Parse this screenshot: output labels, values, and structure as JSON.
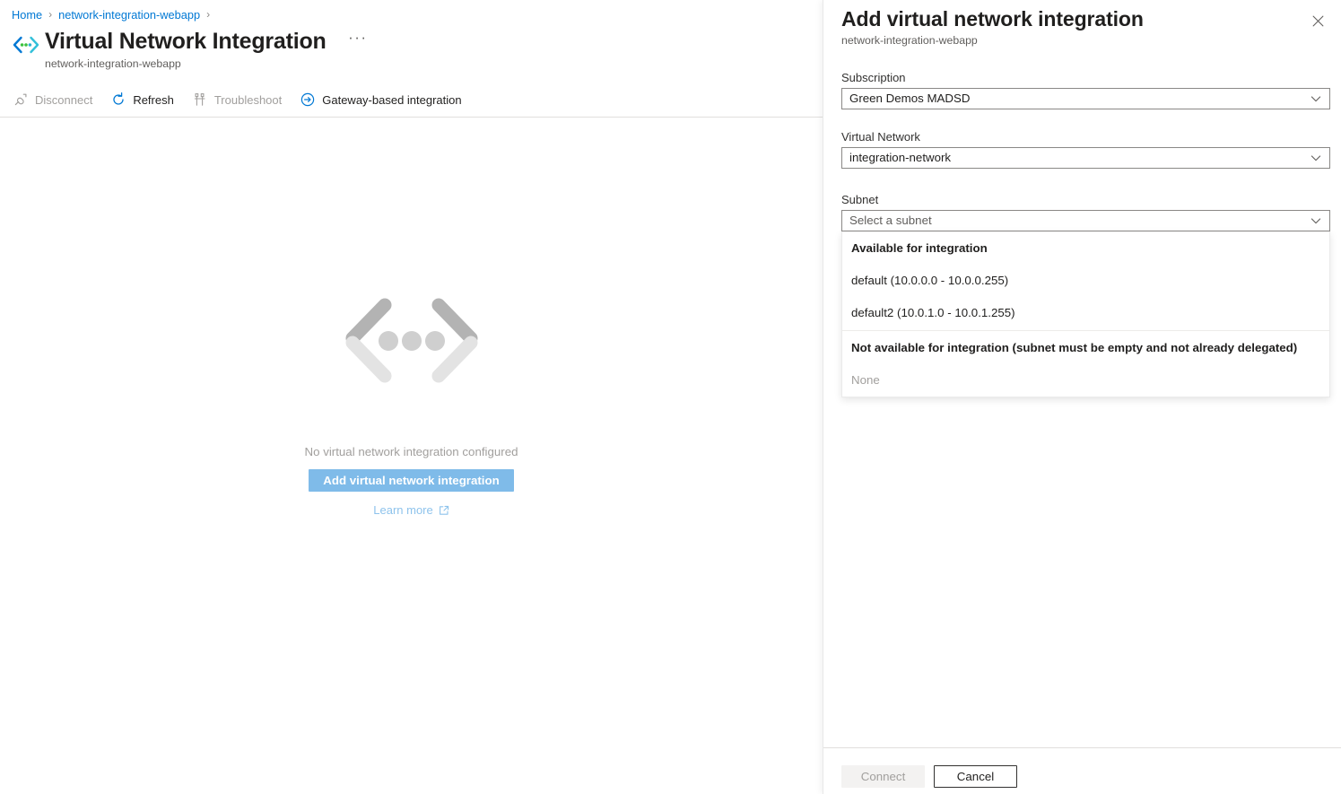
{
  "breadcrumb": {
    "items": [
      {
        "label": "Home"
      },
      {
        "label": "network-integration-webapp"
      }
    ],
    "separator": "›"
  },
  "blade": {
    "icon": "vnet-integration-icon",
    "title": "Virtual Network Integration",
    "subtitle": "network-integration-webapp",
    "ellipsis": "···"
  },
  "commandbar": {
    "items": [
      {
        "label": "Disconnect",
        "icon": "disconnect-icon",
        "enabled": false
      },
      {
        "label": "Refresh",
        "icon": "refresh-icon",
        "enabled": true
      },
      {
        "label": "Troubleshoot",
        "icon": "troubleshoot-icon",
        "enabled": false
      },
      {
        "label": "Gateway-based integration",
        "icon": "arrow-right-circle-icon",
        "enabled": true
      }
    ]
  },
  "empty_state": {
    "icon": "angle-brackets-dots-icon",
    "message": "No virtual network integration configured",
    "primary_button": "Add virtual network integration",
    "link": "Learn more",
    "link_icon": "external-link-icon"
  },
  "panel": {
    "title": "Add virtual network integration",
    "subtitle": "network-integration-webapp",
    "close_icon": "close-icon",
    "fields": {
      "subscription": {
        "label": "Subscription",
        "value": "Green Demos MADSD",
        "chevron": "chevron-down-icon"
      },
      "virtual_network": {
        "label": "Virtual Network",
        "value": "integration-network",
        "chevron": "chevron-down-icon"
      },
      "subnet": {
        "label": "Subnet",
        "placeholder": "Select a subnet",
        "value": "Select a subnet",
        "chevron": "chevron-down-icon"
      }
    },
    "subnet_callout": {
      "groups": [
        {
          "header": "Available for integration",
          "options": [
            {
              "label": "default (10.0.0.0 - 10.0.0.255)",
              "disabled": false
            },
            {
              "label": "default2 (10.0.1.0 - 10.0.1.255)",
              "disabled": false
            }
          ]
        },
        {
          "header": "Not available for integration (subnet must be empty and not already delegated)",
          "options": [
            {
              "label": "None",
              "disabled": true
            }
          ]
        }
      ]
    },
    "footer": {
      "connect_label": "Connect",
      "cancel_label": "Cancel"
    }
  },
  "colors": {
    "link_blue": "#0078d4",
    "accent_button": "#7fbbe9",
    "dim_link": "#8ec3ec",
    "icon_blue": "#0078d4",
    "icon_green": "#3cc23f",
    "border_gray": "#8a8886",
    "divider": "#e1dfdd"
  }
}
